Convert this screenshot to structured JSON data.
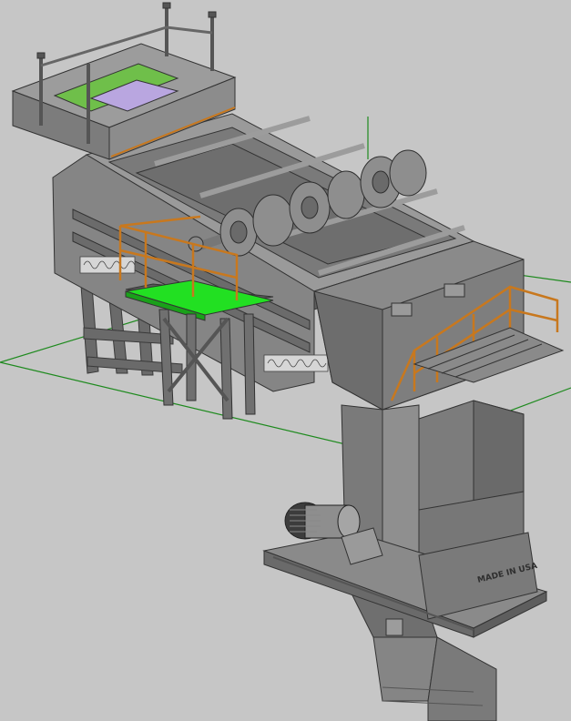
{
  "viewport": {
    "background_color": "#c6c6c6",
    "grid_line_color": "#1e8a1e",
    "steel_color": "#7d7d7d",
    "steel_dark_color": "#4a4a4a",
    "steel_light_color": "#a8a8a8",
    "handrail_color": "#c8781e",
    "walkway_color": "#22e022",
    "screen_panel_color": "#6fbf4a",
    "screen_inner_color": "#b9a6e0"
  },
  "model": {
    "nameplate_text": "MADE IN USA"
  }
}
